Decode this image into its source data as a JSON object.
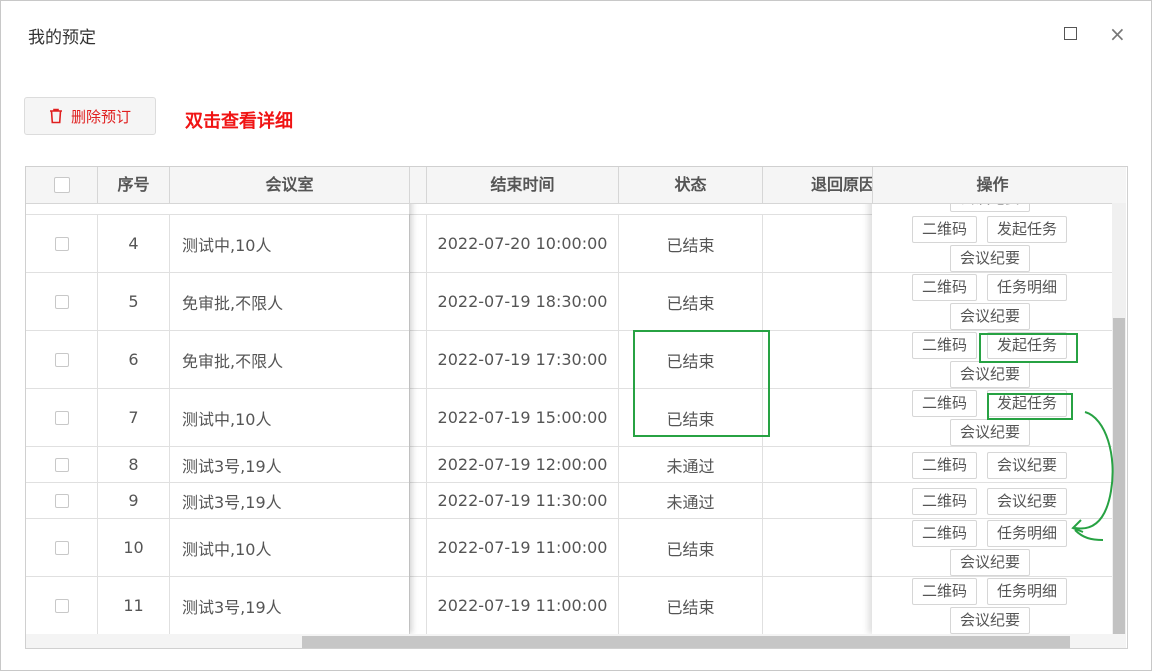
{
  "dialog": {
    "title": "我的预定"
  },
  "toolbar": {
    "delete_label": "删除预订",
    "hint": "双击查看详细"
  },
  "table": {
    "headers": {
      "seq": "序号",
      "room": "会议室",
      "end_time": "结束时间",
      "status": "状态",
      "reject_reason": "退回原因",
      "actions": "操作"
    },
    "partial_top_action": "会议纪要",
    "rows": [
      {
        "seq": "4",
        "room": "测试中,10人",
        "end_time": "2022-07-20 10:00:00",
        "status": "已结束",
        "actions": [
          "二维码",
          "发起任务",
          "会议纪要"
        ]
      },
      {
        "seq": "5",
        "room": "免审批,不限人",
        "end_time": "2022-07-19 18:30:00",
        "status": "已结束",
        "actions": [
          "二维码",
          "任务明细",
          "会议纪要"
        ]
      },
      {
        "seq": "6",
        "room": "免审批,不限人",
        "end_time": "2022-07-19 17:30:00",
        "status": "已结束",
        "actions": [
          "二维码",
          "发起任务",
          "会议纪要"
        ]
      },
      {
        "seq": "7",
        "room": "测试中,10人",
        "end_time": "2022-07-19 15:00:00",
        "status": "已结束",
        "actions": [
          "二维码",
          "发起任务",
          "会议纪要"
        ]
      },
      {
        "seq": "8",
        "room": "测试3号,19人",
        "end_time": "2022-07-19 12:00:00",
        "status": "未通过",
        "actions": [
          "二维码",
          "会议纪要"
        ]
      },
      {
        "seq": "9",
        "room": "测试3号,19人",
        "end_time": "2022-07-19 11:30:00",
        "status": "未通过",
        "actions": [
          "二维码",
          "会议纪要"
        ]
      },
      {
        "seq": "10",
        "room": "测试中,10人",
        "end_time": "2022-07-19 11:00:00",
        "status": "已结束",
        "actions": [
          "二维码",
          "任务明细",
          "会议纪要"
        ]
      },
      {
        "seq": "11",
        "room": "测试3号,19人",
        "end_time": "2022-07-19 11:00:00",
        "status": "已结束",
        "actions": [
          "二维码",
          "任务明细",
          "会议纪要"
        ]
      }
    ]
  },
  "colors": {
    "danger": "#e02020",
    "hint": "#f01414",
    "annotation": "#27a243"
  }
}
